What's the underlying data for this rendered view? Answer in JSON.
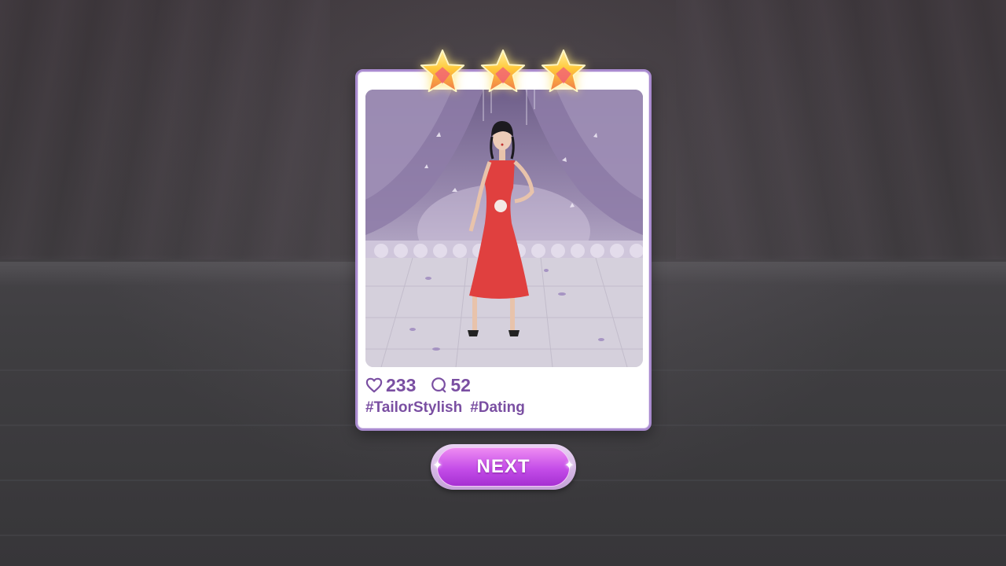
{
  "result": {
    "likes": "233",
    "comments": "52",
    "hashtags": [
      "#TailorStylish",
      "#Dating"
    ],
    "stars_earned": 3,
    "stars_total": 3
  },
  "next_button": {
    "label": "NEXT"
  },
  "icons": {
    "like": "heart-outline-icon",
    "comment": "speech-bubble-icon",
    "star": "gold-star-icon"
  },
  "colors": {
    "accent_text": "#7a4fa2",
    "card_border": "#a98bcf",
    "button_top": "#ee8bf2",
    "button_bottom": "#a630d2",
    "star_gold": "#ffd84a",
    "dress_red": "#e0403f"
  }
}
